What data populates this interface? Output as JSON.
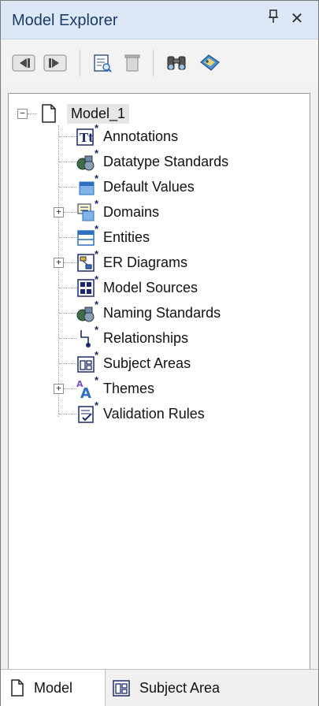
{
  "panel": {
    "title": "Model Explorer",
    "pin_glyph": "❙",
    "close_glyph": "✕"
  },
  "toolbar": {
    "items": [
      {
        "name": "back-button",
        "icon": "nav-back-icon"
      },
      {
        "name": "forward-button",
        "icon": "nav-forward-icon"
      },
      {
        "name": "properties-button",
        "icon": "properties-icon"
      },
      {
        "name": "delete-button",
        "icon": "trash-icon"
      },
      {
        "name": "find-button",
        "icon": "binoculars-icon"
      },
      {
        "name": "tag-button",
        "icon": "tag-icon"
      }
    ]
  },
  "tree": {
    "root": {
      "label": "Model_1",
      "expander": "−"
    },
    "items": [
      {
        "label": "Annotations",
        "icon": "annotations-icon",
        "expandable": false
      },
      {
        "label": "Datatype Standards",
        "icon": "datatype-standards-icon",
        "expandable": false
      },
      {
        "label": "Default Values",
        "icon": "default-values-icon",
        "expandable": false
      },
      {
        "label": "Domains",
        "icon": "domains-icon",
        "expandable": true
      },
      {
        "label": "Entities",
        "icon": "entities-icon",
        "expandable": false
      },
      {
        "label": "ER Diagrams",
        "icon": "er-diagrams-icon",
        "expandable": true
      },
      {
        "label": "Model Sources",
        "icon": "model-sources-icon",
        "expandable": false
      },
      {
        "label": "Naming Standards",
        "icon": "naming-standards-icon",
        "expandable": false
      },
      {
        "label": "Relationships",
        "icon": "relationships-icon",
        "expandable": false
      },
      {
        "label": "Subject Areas",
        "icon": "subject-areas-icon",
        "expandable": false
      },
      {
        "label": "Themes",
        "icon": "themes-icon",
        "expandable": true
      },
      {
        "label": "Validation Rules",
        "icon": "validation-rules-icon",
        "expandable": false
      }
    ],
    "expander_plus": "+"
  },
  "tabs": [
    {
      "label": "Model",
      "icon": "document-icon",
      "active": true
    },
    {
      "label": "Subject Area",
      "icon": "subject-area-icon",
      "active": false
    }
  ],
  "colors": {
    "title_bg": "#dce8f6",
    "title_text": "#1e3a66",
    "accent_blue": "#2f6fc0",
    "icon_navy": "#1a2a6b"
  }
}
